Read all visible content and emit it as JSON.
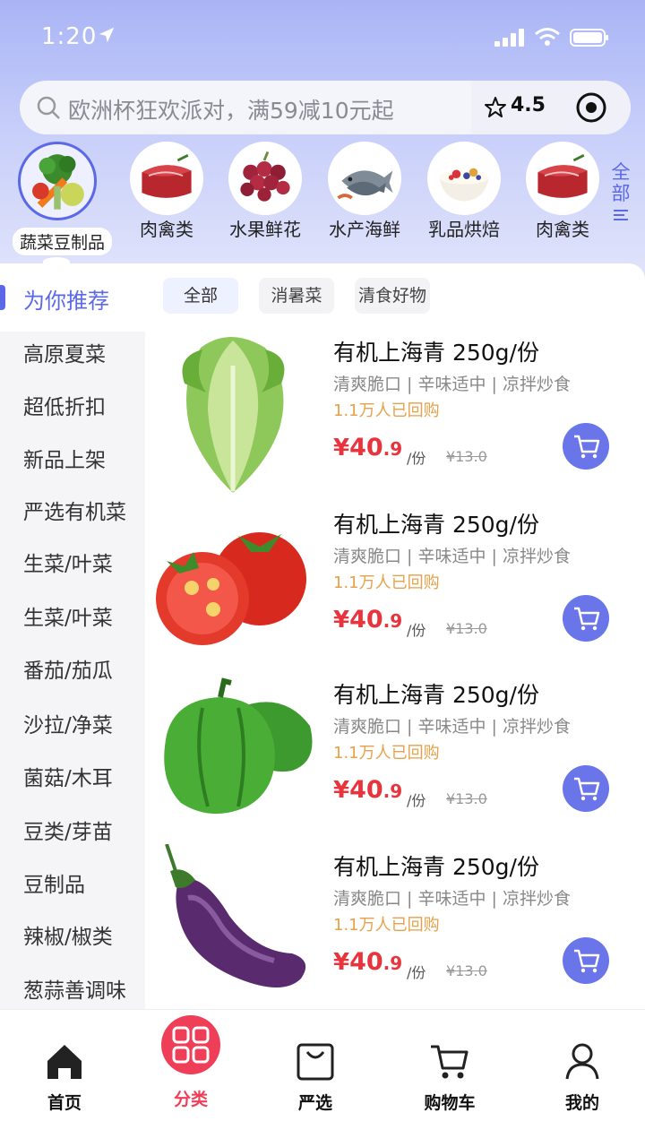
{
  "status_bar": {
    "time": "1:20"
  },
  "search": {
    "placeholder": "欧洲杯狂欢派对，满59减10元起",
    "rating": "4.5"
  },
  "categories": [
    {
      "label": "蔬菜豆制品",
      "icon": "vegetables"
    },
    {
      "label": "肉禽类",
      "icon": "meat"
    },
    {
      "label": "水果鲜花",
      "icon": "grapes"
    },
    {
      "label": "水产海鲜",
      "icon": "fish"
    },
    {
      "label": "乳品烘焙",
      "icon": "yogurt"
    },
    {
      "label": "肉禽类",
      "icon": "meat"
    }
  ],
  "all_categories": {
    "label_1": "全",
    "label_2": "部"
  },
  "sidebar": {
    "active": "为你推荐",
    "items": [
      "高原夏菜",
      "超低折扣",
      "新品上架",
      "严选有机菜",
      "生菜/叶菜",
      "生菜/叶菜",
      "番茄/茄瓜",
      "沙拉/净菜",
      "菌菇/木耳",
      "豆类/芽苗",
      "豆制品",
      "辣椒/椒类",
      "葱蒜善调味"
    ]
  },
  "filters": [
    "全部",
    "消暑菜",
    "清食好物"
  ],
  "products": [
    {
      "name": "有机上海青 250g/份",
      "desc": "清爽脆口 | 辛味适中 | 凉拌炒食",
      "sold": "1.1万人已回购",
      "currency": "¥",
      "price_int": "40",
      "price_dec": ".9",
      "unit": "/份",
      "original": "¥13.0",
      "image": "lettuce"
    },
    {
      "name": "有机上海青 250g/份",
      "desc": "清爽脆口 | 辛味适中 | 凉拌炒食",
      "sold": "1.1万人已回购",
      "currency": "¥",
      "price_int": "40",
      "price_dec": ".9",
      "unit": "/份",
      "original": "¥13.0",
      "image": "tomato"
    },
    {
      "name": "有机上海青 250g/份",
      "desc": "清爽脆口 | 辛味适中 | 凉拌炒食",
      "sold": "1.1万人已回购",
      "currency": "¥",
      "price_int": "40",
      "price_dec": ".9",
      "unit": "/份",
      "original": "¥13.0",
      "image": "pepper"
    },
    {
      "name": "有机上海青 250g/份",
      "desc": "清爽脆口 | 辛味适中 | 凉拌炒食",
      "sold": "1.1万人已回购",
      "currency": "¥",
      "price_int": "40",
      "price_dec": ".9",
      "unit": "/份",
      "original": "¥13.0",
      "image": "eggplant"
    }
  ],
  "tabbar": [
    {
      "label": "首页",
      "icon": "home-icon"
    },
    {
      "label": "分类",
      "icon": "grid-icon",
      "active": true
    },
    {
      "label": "严选",
      "icon": "bag-icon"
    },
    {
      "label": "购物车",
      "icon": "cart-icon"
    },
    {
      "label": "我的",
      "icon": "user-icon"
    }
  ],
  "colors": {
    "accent": "#5b68e8",
    "price": "#e8343c",
    "sold": "#e5a24a",
    "tab_active": "#ef3e58"
  }
}
